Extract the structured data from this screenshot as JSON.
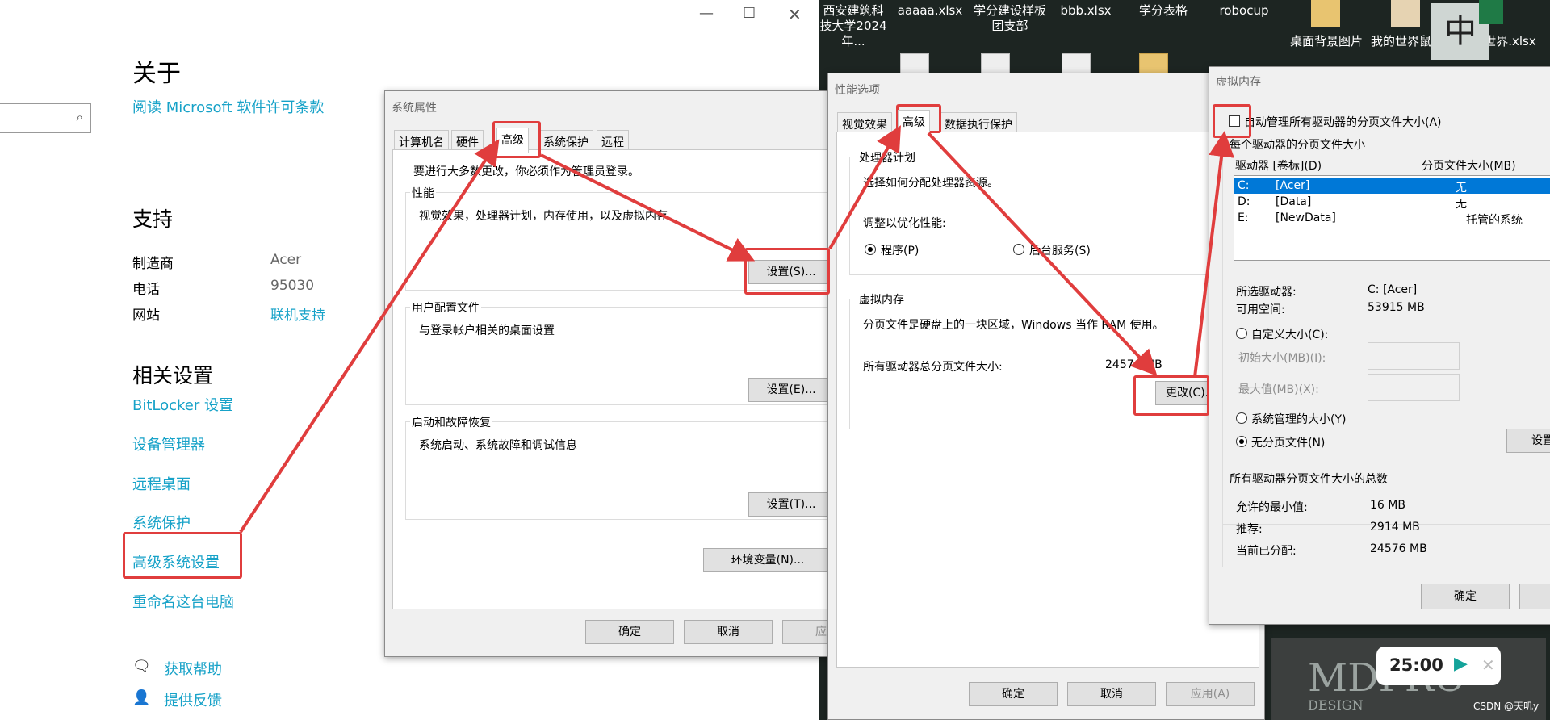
{
  "settings": {
    "about_title": "关于",
    "license_link": "阅读 Microsoft 软件许可条款",
    "support_title": "支持",
    "support_rows": [
      {
        "key": "制造商",
        "value": "Acer"
      },
      {
        "key": "电话",
        "value": "95030"
      },
      {
        "key": "网站",
        "value": "联机支持"
      }
    ],
    "related_title": "相关设置",
    "related_links": [
      "BitLocker 设置",
      "设备管理器",
      "远程桌面",
      "系统保护",
      "高级系统设置",
      "重命名这台电脑"
    ],
    "help": "获取帮助",
    "feedback": "提供反馈"
  },
  "desktop": {
    "icons": [
      "西安建筑科技大学2024年...",
      "aaaaa.xlsx",
      "学分建设样板团支部",
      "bbb.xlsx",
      "学分表格",
      "robocup",
      "桌面背景图片",
      "我的世界鼠标",
      "的世界.xlsx"
    ],
    "ime_label": "中",
    "timer": "25:00",
    "watermark_brand": "MDPRO",
    "watermark_sub": "DESIGN",
    "credit": "CSDN @天叽y"
  },
  "sysprops": {
    "title": "系统属性",
    "tabs": [
      "计算机名",
      "硬件",
      "高级",
      "系统保护",
      "远程"
    ],
    "admin_note": "要进行大多数更改，你必须作为管理员登录。",
    "perf_label": "性能",
    "perf_desc": "视觉效果，处理器计划，内存使用，以及虚拟内存",
    "perf_btn": "设置(S)...",
    "profile_label": "用户配置文件",
    "profile_desc": "与登录帐户相关的桌面设置",
    "profile_btn": "设置(E)...",
    "startup_label": "启动和故障恢复",
    "startup_desc": "系统启动、系统故障和调试信息",
    "startup_btn": "设置(T)...",
    "env_btn": "环境变量(N)...",
    "ok": "确定",
    "cancel": "取消",
    "apply": "应用"
  },
  "perfopts": {
    "title": "性能选项",
    "tabs": [
      "视觉效果",
      "高级",
      "数据执行保护"
    ],
    "cpu_label": "处理器计划",
    "cpu_desc": "选择如何分配处理器资源。",
    "optimize_label": "调整以优化性能:",
    "opt_programs": "程序(P)",
    "opt_services": "后台服务(S)",
    "vm_label": "虚拟内存",
    "vm_desc": "分页文件是硬盘上的一块区域，Windows 当作 RAM 使用。",
    "vm_total_label": "所有驱动器总分页文件大小:",
    "vm_total_value": "24576 MB",
    "change_btn": "更改(C)...",
    "ok": "确定",
    "cancel": "取消",
    "apply": "应用(A)"
  },
  "vmem": {
    "title": "虚拟内存",
    "auto_manage": "自动管理所有驱动器的分页文件大小(A)",
    "auto_checked": false,
    "per_drive_label": "每个驱动器的分页文件大小",
    "col_drive": "驱动器 [卷标](D)",
    "col_size": "分页文件大小(MB)",
    "drives": [
      {
        "letter": "C:",
        "label": "[Acer]",
        "size": "无"
      },
      {
        "letter": "D:",
        "label": "[Data]",
        "size": "无"
      },
      {
        "letter": "E:",
        "label": "[NewData]",
        "size": "托管的系统"
      }
    ],
    "sel_drive_label": "所选驱动器:",
    "sel_drive_value": "C:  [Acer]",
    "free_label": "可用空间:",
    "free_value": "53915 MB",
    "custom_size": "自定义大小(C):",
    "initial_size": "初始大小(MB)(I):",
    "max_size": "最大值(MB)(X):",
    "system_managed": "系统管理的大小(Y)",
    "no_paging": "无分页文件(N)",
    "set_btn": "设置",
    "total_label": "所有驱动器分页文件大小的总数",
    "min_label": "允许的最小值:",
    "min_value": "16 MB",
    "rec_label": "推荐:",
    "rec_value": "2914 MB",
    "cur_label": "当前已分配:",
    "cur_value": "24576 MB",
    "ok": "确定"
  },
  "annotation_color": "#e03d3d"
}
